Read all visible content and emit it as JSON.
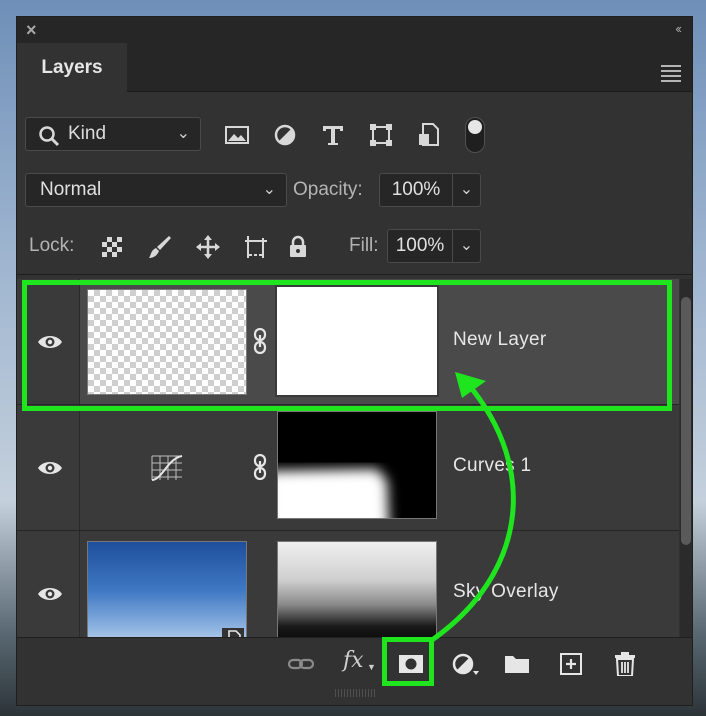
{
  "panel": {
    "title": "Layers",
    "close_glyph": "×",
    "collapse_glyph": "‹‹",
    "menu_icon": "panel-menu-icon"
  },
  "filter": {
    "kind_label": "Kind",
    "icons": [
      "image-filter-icon",
      "adjustment-filter-icon",
      "type-filter-icon",
      "shape-filter-icon",
      "smart-object-filter-icon"
    ]
  },
  "blend": {
    "mode": "Normal",
    "opacity_label": "Opacity:",
    "opacity_value": "100%"
  },
  "lock": {
    "label": "Lock:",
    "icons": [
      "lock-transparent-pixels-icon",
      "lock-image-pixels-icon",
      "lock-position-icon",
      "lock-artboard-icon",
      "lock-all-icon"
    ],
    "fill_label": "Fill:",
    "fill_value": "100%"
  },
  "layers": [
    {
      "name": "New Layer",
      "selected": true
    },
    {
      "name": "Curves 1",
      "selected": false
    },
    {
      "name": "Sky Overlay",
      "selected": false
    }
  ],
  "footer": {
    "fx_label": "fx",
    "icons": [
      "link-layers-icon",
      "fx-icon",
      "add-mask-icon",
      "new-fill-adjustment-icon",
      "new-group-icon",
      "new-layer-icon",
      "delete-icon"
    ]
  },
  "colors": {
    "highlight": "#1fe51f",
    "panel_bg": "#323232",
    "selected_row": "#4a4a4a"
  }
}
